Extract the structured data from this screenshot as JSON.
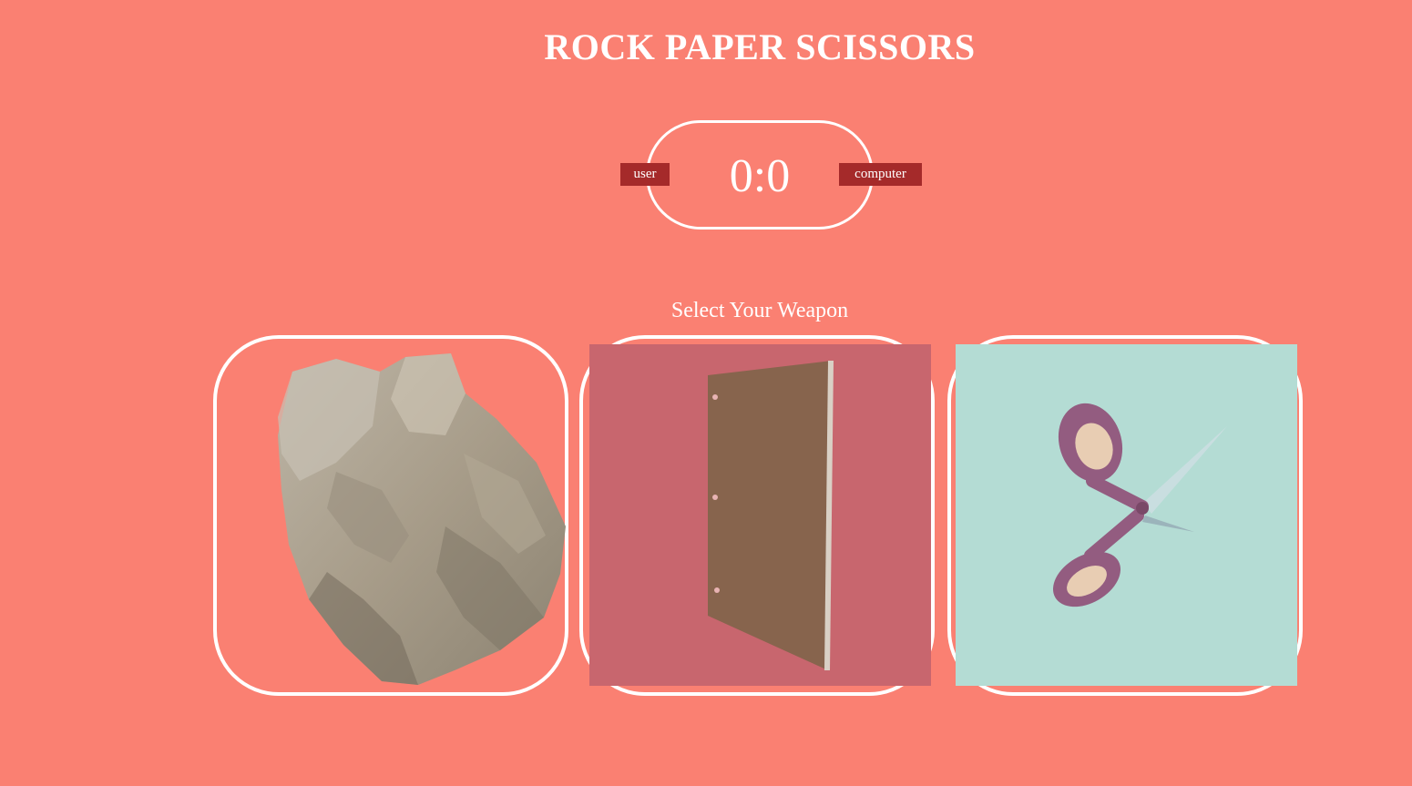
{
  "header": {
    "title": "ROCK PAPER SCISSORS"
  },
  "scoreboard": {
    "user_label": "user",
    "computer_label": "computer",
    "score": "0:0"
  },
  "prompt": {
    "message": "Select Your Weapon"
  },
  "choices": [
    {
      "id": "rock",
      "icon": "rock-image"
    },
    {
      "id": "paper",
      "icon": "paper-image"
    },
    {
      "id": "scissors",
      "icon": "scissors-image"
    }
  ],
  "colors": {
    "background": "#fa8072",
    "badge": "#a52a2a",
    "paper_tile": "#c8666e",
    "scissors_tile": "#b4dcd4",
    "text": "#ffffff"
  }
}
